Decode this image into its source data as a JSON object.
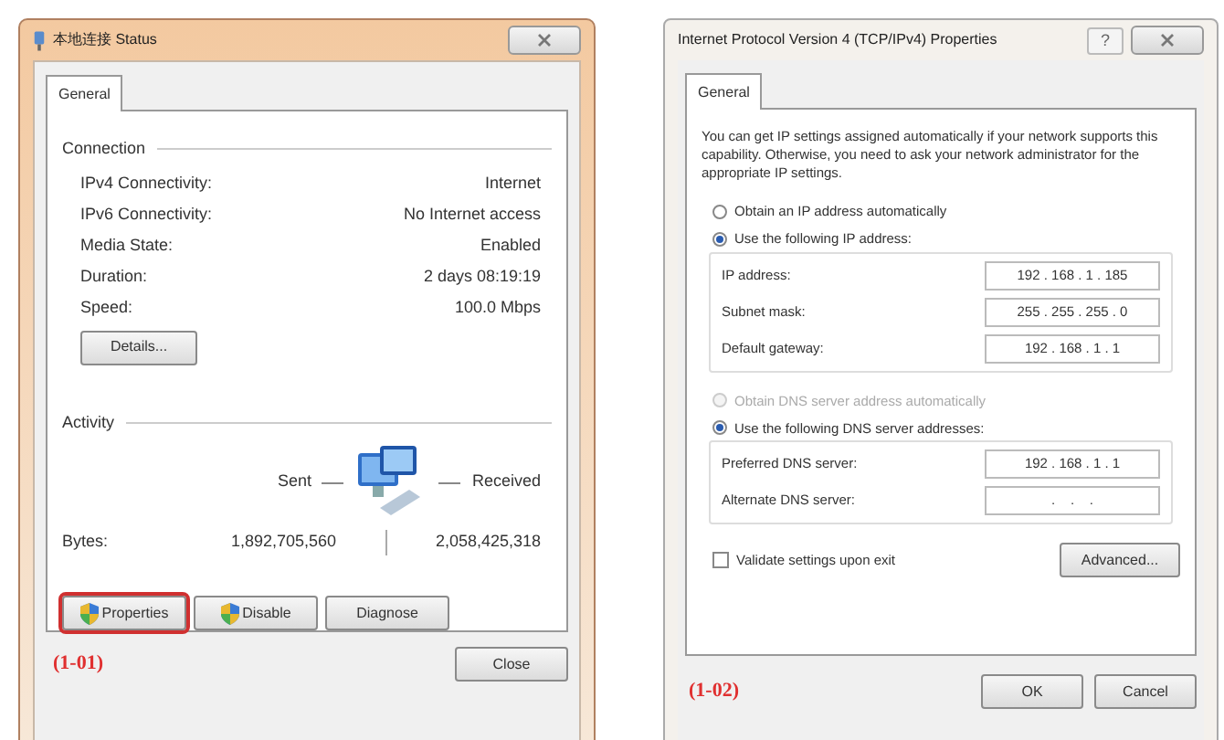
{
  "left_dialog": {
    "title": "本地连接 Status",
    "tabs": [
      {
        "label": "General",
        "selected": true
      }
    ],
    "connection": {
      "heading": "Connection",
      "rows": [
        {
          "label": "IPv4 Connectivity:",
          "value": "Internet"
        },
        {
          "label": "IPv6 Connectivity:",
          "value": "No Internet access"
        },
        {
          "label": "Media State:",
          "value": "Enabled"
        },
        {
          "label": "Duration:",
          "value": "2 days 08:19:19"
        },
        {
          "label": "Speed:",
          "value": "100.0 Mbps"
        }
      ]
    },
    "details_button": "Details...",
    "activity": {
      "heading": "Activity",
      "sent_label": "Sent",
      "received_label": "Received",
      "bytes_label": "Bytes:",
      "sent": "1,892,705,560",
      "received": "2,058,425,318"
    },
    "buttons": [
      {
        "label": "Properties",
        "kind": "shield",
        "highlighted": true
      },
      {
        "label": "Disable",
        "kind": "shield",
        "highlighted": false
      },
      {
        "label": "Diagnose",
        "kind": "plain",
        "highlighted": false
      }
    ],
    "figure_label": "(1-01)",
    "close_button": "Close"
  },
  "right_dialog": {
    "title": "Internet Protocol Version 4 (TCP/IPv4) Properties",
    "help_button": "?",
    "tabs": [
      {
        "label": "General",
        "selected": true
      }
    ],
    "intro": "You can get IP settings assigned automatically if your network supports this capability. Otherwise, you need to ask your network administrator for the appropriate IP settings.",
    "ip_options": [
      {
        "label": "Obtain an IP address automatically",
        "selected": false,
        "disabled": false
      },
      {
        "label": "Use the following IP address:",
        "selected": true,
        "disabled": false
      }
    ],
    "ip_fields": [
      {
        "label": "IP address:",
        "value": "192 . 168 . 1 . 185"
      },
      {
        "label": "Subnet mask:",
        "value": "255 . 255 . 255 . 0"
      },
      {
        "label": "Default gateway:",
        "value": "192 . 168 . 1 . 1"
      }
    ],
    "dns_options": [
      {
        "label": "Obtain DNS server address automatically",
        "selected": false,
        "disabled": true
      },
      {
        "label": "Use the following DNS server addresses:",
        "selected": true,
        "disabled": false
      }
    ],
    "dns_fields": [
      {
        "label": "Preferred DNS server:",
        "value": "192 . 168 . 1 . 1"
      },
      {
        "label": "Alternate DNS server:",
        "value": ".    .    ."
      }
    ],
    "validate": {
      "label": "Validate settings upon exit",
      "checked": false
    },
    "advanced_button": "Advanced...",
    "figure_label": "(1-02)",
    "buttons": [
      "OK",
      "Cancel"
    ]
  }
}
